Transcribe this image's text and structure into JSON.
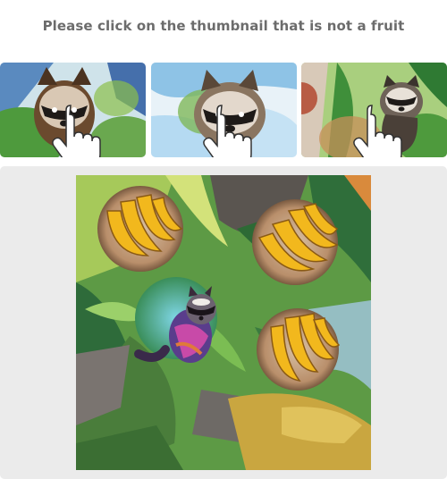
{
  "instruction": "Please click on the thumbnail that is not a fruit",
  "thumbnails": [
    {
      "subject": "raccoon",
      "icon": "hand-pointer-icon"
    },
    {
      "subject": "raccoon",
      "icon": "hand-pointer-icon"
    },
    {
      "subject": "raccoon",
      "icon": "hand-pointer-icon"
    }
  ],
  "main_image": {
    "items": [
      "banana-bunch",
      "banana-bunch",
      "raccoon",
      "banana-bunch"
    ]
  },
  "colors": {
    "instruction_text": "#6c6c6c",
    "panel_bg": "#ebebeb",
    "banana": "#f2b81d",
    "leaf": "#3f8f3a"
  }
}
